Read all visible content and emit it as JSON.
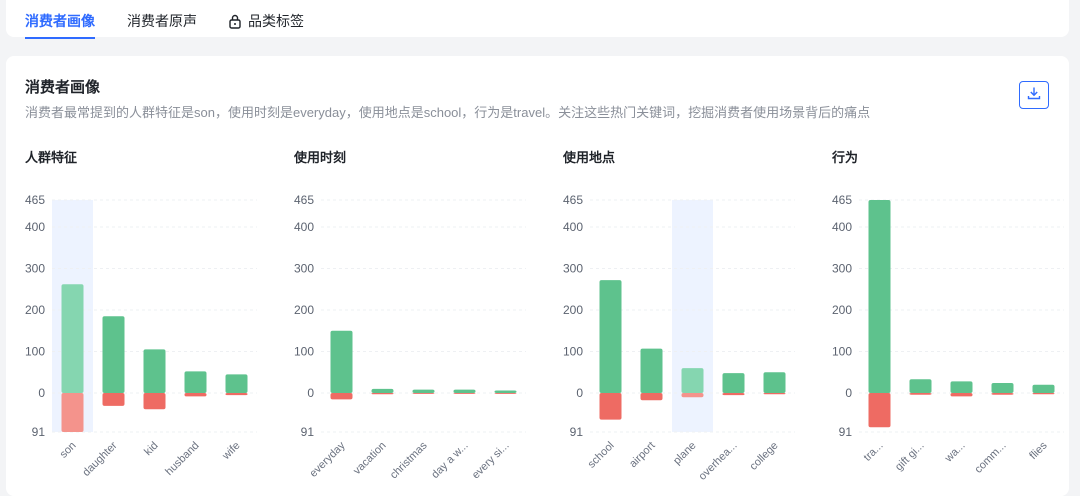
{
  "tabs": [
    {
      "label": "消费者画像",
      "active": true
    },
    {
      "label": "消费者原声",
      "active": false
    },
    {
      "label": "品类标签",
      "active": false,
      "icon": "lock-icon"
    }
  ],
  "section": {
    "title": "消费者画像",
    "description": "消费者最常提到的人群特征是son，使用时刻是everyday，使用地点是school，行为是travel。关注这些热门关键词，挖掘消费者使用场景背后的痛点",
    "download_icon": "download-icon"
  },
  "colors": {
    "positive": "#5ec28d",
    "negative": "#ee6b63",
    "positive_highlight": "#85d6b0",
    "negative_highlight": "#f4938c",
    "highlight_band": "#edf3ff",
    "accent": "#2f6bff"
  },
  "chart_data": [
    {
      "type": "bar",
      "title": "人群特征",
      "yticks": [
        "465",
        "400",
        "300",
        "200",
        "100",
        "0",
        "91"
      ],
      "categories": [
        "son",
        "daughter",
        "kid",
        "husband",
        "wife"
      ],
      "series": [
        {
          "values": [
            262,
            185,
            105,
            52,
            45
          ]
        },
        {
          "values": [
            -91,
            -30,
            -38,
            -8,
            -5
          ]
        }
      ],
      "highlight": 0
    },
    {
      "type": "bar",
      "title": "使用时刻",
      "yticks": [
        "465",
        "400",
        "300",
        "200",
        "100",
        "0",
        "91"
      ],
      "categories": [
        "everyday",
        "vacation",
        "christmas",
        "day a w...",
        "every si..."
      ],
      "series": [
        {
          "values": [
            150,
            10,
            8,
            8,
            6
          ]
        },
        {
          "values": [
            -15,
            -3,
            -2,
            -2,
            -2
          ]
        }
      ],
      "highlight": null
    },
    {
      "type": "bar",
      "title": "使用地点",
      "yticks": [
        "465",
        "400",
        "300",
        "200",
        "100",
        "0",
        "91"
      ],
      "categories": [
        "school",
        "airport",
        "plane",
        "overhea...",
        "college"
      ],
      "series": [
        {
          "values": [
            272,
            107,
            60,
            48,
            50
          ]
        },
        {
          "values": [
            -62,
            -17,
            -10,
            -5,
            -3
          ]
        }
      ],
      "highlight": 2
    },
    {
      "type": "bar",
      "title": "行为",
      "yticks": [
        "465",
        "400",
        "300",
        "200",
        "100",
        "0",
        "91"
      ],
      "categories": [
        "tra...",
        "gift gi...",
        "wa...",
        "comm...",
        "flies"
      ],
      "series": [
        {
          "values": [
            465,
            33,
            28,
            24,
            20
          ]
        },
        {
          "values": [
            -80,
            -4,
            -8,
            -4,
            -3
          ]
        }
      ],
      "highlight": null
    }
  ]
}
